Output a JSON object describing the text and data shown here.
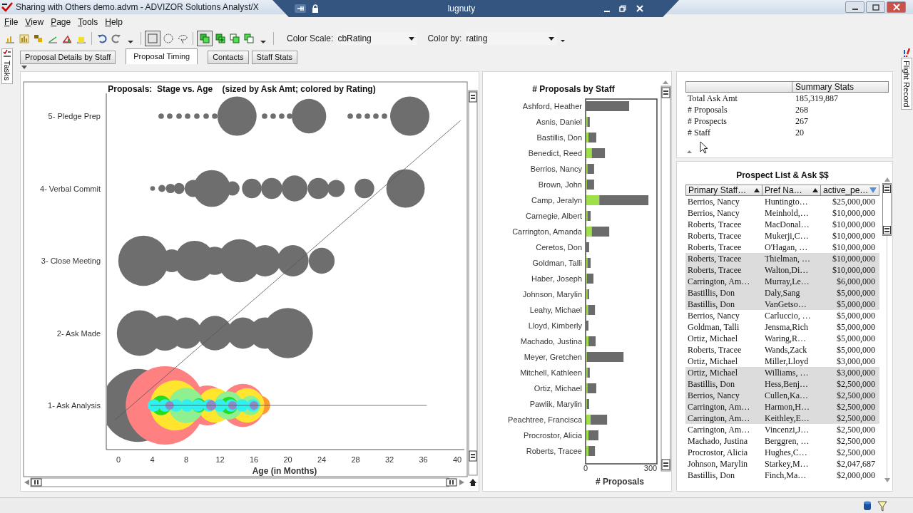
{
  "window": {
    "title": "Sharing with Others demo.advm - ADVIZOR Solutions Analyst/X"
  },
  "remote_bar": {
    "label": "lugnuty"
  },
  "menu": [
    "File",
    "View",
    "Page",
    "Tools",
    "Help"
  ],
  "tools": [
    {
      "kind": "bar-chart",
      "pressed": false
    },
    {
      "kind": "column-chart",
      "pressed": false
    },
    {
      "kind": "block-chart",
      "pressed": false
    },
    {
      "kind": "line-chart",
      "pressed": false
    },
    {
      "kind": "area-chart",
      "pressed": false
    },
    {
      "kind": "histogram-chart",
      "pressed": false
    },
    {
      "kind": "separator",
      "pressed": false
    },
    {
      "kind": "undo",
      "pressed": false
    },
    {
      "kind": "redo",
      "pressed": false
    },
    {
      "kind": "caret",
      "pressed": false
    },
    {
      "kind": "separator",
      "pressed": false
    },
    {
      "kind": "rect-select",
      "pressed": true
    },
    {
      "kind": "circle-select",
      "pressed": false
    },
    {
      "kind": "lasso-select",
      "pressed": false
    },
    {
      "kind": "separator",
      "pressed": false
    },
    {
      "kind": "layer-add",
      "pressed": true
    },
    {
      "kind": "layer-plus",
      "pressed": false
    },
    {
      "kind": "layer-copy",
      "pressed": false
    },
    {
      "kind": "layer-merge",
      "pressed": false
    },
    {
      "kind": "caret",
      "pressed": false
    },
    {
      "kind": "separator",
      "pressed": false
    }
  ],
  "color_scale": {
    "label": "Color Scale:",
    "value": "cbRating"
  },
  "color_by": {
    "label": "Color by:",
    "value": "rating"
  },
  "left_tab": "Tasks",
  "right_tab": "Flight Record",
  "tabs": [
    {
      "label": "Proposal Details by Staff",
      "selected": false
    },
    {
      "label": "Proposal Timing",
      "selected": true
    },
    {
      "label": "Contacts",
      "selected": false
    },
    {
      "label": "Staff Stats",
      "selected": false
    }
  ],
  "bubble_chart": {
    "title": "Proposals:  Stage vs. Age    (sized by Ask Amt; colored by Rating)",
    "stage_labels": [
      "5- Pledge Prep",
      "4- Verbal Commit",
      "3- Close Meeting",
      "2- Ask Made",
      "1- Ask Analysis"
    ],
    "x_ticks": [
      "0",
      "4",
      "8",
      "12",
      "16",
      "20",
      "24",
      "28",
      "32",
      "36",
      "40"
    ],
    "xlabel": "Age (in Months)"
  },
  "bar_chart": {
    "chart_data": {
      "type": "bar",
      "orientation": "horizontal",
      "stacked": true,
      "title": "# Proposals by Staff",
      "xlabel": "# Proposals",
      "categories": [
        "Ashford, Heather",
        "Asnis, Daniel",
        "Bastillis, Don",
        "Benedict, Reed",
        "Berrios, Nancy",
        "Brown, John",
        "Camp, Jeralyn",
        "Carnegie, Albert",
        "Carrington, Amanda",
        "Ceretos, Don",
        "Goldman, Talli",
        "Haber, Joseph",
        "Johnson, Marylin",
        "Leahy, Michael",
        "Lloyd, Kimberly",
        "Machado, Justina",
        "Meyer, Gretchen",
        "Mitchell, Kathleen",
        "Ortiz, Michael",
        "Pawlik, Marylin",
        "Peachtree, Francisca",
        "Procrostor, Alicia",
        "Roberts, Tracee"
      ],
      "xlim": [
        0,
        300
      ],
      "xticks": [
        0,
        300
      ],
      "series": [
        {
          "color": "#9ee04a",
          "values": [
            0,
            5,
            10,
            25,
            5,
            3,
            60,
            5,
            25,
            0,
            5,
            3,
            5,
            8,
            0,
            10,
            3,
            5,
            5,
            3,
            20,
            10,
            10
          ]
        },
        {
          "color": "#6b6b6b",
          "values": [
            198,
            11,
            36,
            61,
            31,
            33,
            227,
            15,
            81,
            13,
            15,
            30,
            8,
            32,
            10,
            33,
            169,
            11,
            41,
            10,
            76,
            46,
            30
          ]
        }
      ]
    }
  },
  "summary": {
    "header": "Summary Stats",
    "rows": [
      {
        "label": "Total Ask Amt",
        "value": "185,319,887"
      },
      {
        "label": "# Proposals",
        "value": "268"
      },
      {
        "label": "# Prospects",
        "value": "267"
      },
      {
        "label": "# Staff",
        "value": "20"
      }
    ]
  },
  "prospects": {
    "title": "Prospect List & Ask $$",
    "columns": [
      {
        "label": "Primary Staff…",
        "descending": false
      },
      {
        "label": "Pref Na…",
        "descending": false
      },
      {
        "label": "active_pe…",
        "descending": true
      }
    ],
    "rows": [
      {
        "cells": [
          "Berrios, Nancy",
          "Huntingto…",
          "$25,000,000"
        ],
        "selected": false
      },
      {
        "cells": [
          "Berrios, Nancy",
          "Meinhold,…",
          "$10,000,000"
        ],
        "selected": false
      },
      {
        "cells": [
          "Roberts, Tracee",
          "MacDonal…",
          "$10,000,000"
        ],
        "selected": false
      },
      {
        "cells": [
          "Roberts, Tracee",
          "Mukerji,C…",
          "$10,000,000"
        ],
        "selected": false
      },
      {
        "cells": [
          "Roberts, Tracee",
          "O'Hagan, …",
          "$10,000,000"
        ],
        "selected": false
      },
      {
        "cells": [
          "Roberts, Tracee",
          "Thielman, …",
          "$10,000,000"
        ],
        "selected": true
      },
      {
        "cells": [
          "Roberts, Tracee",
          "Walton,Di…",
          "$10,000,000"
        ],
        "selected": true
      },
      {
        "cells": [
          "Carrington, Am…",
          "Murray,Le…",
          "$6,000,000"
        ],
        "selected": true
      },
      {
        "cells": [
          "Bastillis, Don",
          "Daly,Sang",
          "$5,000,000"
        ],
        "selected": true
      },
      {
        "cells": [
          "Bastillis, Don",
          "VanGetso…",
          "$5,000,000"
        ],
        "selected": true
      },
      {
        "cells": [
          "Berrios, Nancy",
          "Carluccio, …",
          "$5,000,000"
        ],
        "selected": false
      },
      {
        "cells": [
          "Goldman, Talli",
          "Jensma,Rich",
          "$5,000,000"
        ],
        "selected": false
      },
      {
        "cells": [
          "Ortiz, Michael",
          "Waring,R…",
          "$5,000,000"
        ],
        "selected": false
      },
      {
        "cells": [
          "Roberts, Tracee",
          "Wands,Zack",
          "$5,000,000"
        ],
        "selected": false
      },
      {
        "cells": [
          "Ortiz, Michael",
          "Miller,Lloyd",
          "$3,000,000"
        ],
        "selected": false
      },
      {
        "cells": [
          "Ortiz, Michael",
          "Williams, …",
          "$3,000,000"
        ],
        "selected": true
      },
      {
        "cells": [
          "Bastillis, Don",
          "Hess,Benj…",
          "$2,500,000"
        ],
        "selected": true
      },
      {
        "cells": [
          "Berrios, Nancy",
          "Cullen,Ka…",
          "$2,500,000"
        ],
        "selected": true
      },
      {
        "cells": [
          "Carrington, Am…",
          "Harmon,H…",
          "$2,500,000"
        ],
        "selected": true
      },
      {
        "cells": [
          "Carrington, Am…",
          "Keithley,E…",
          "$2,500,000"
        ],
        "selected": true
      },
      {
        "cells": [
          "Carrington, Am…",
          "Vincenzi,J…",
          "$2,500,000"
        ],
        "selected": false
      },
      {
        "cells": [
          "Machado, Justina",
          "Berggren, …",
          "$2,500,000"
        ],
        "selected": false
      },
      {
        "cells": [
          "Procrostor, Alicia",
          "Hughes,C…",
          "$2,500,000"
        ],
        "selected": false
      },
      {
        "cells": [
          "Johnson, Marylin",
          "Starkey,M…",
          "$2,047,687"
        ],
        "selected": false
      },
      {
        "cells": [
          "Bastillis, Don",
          "Finch,Ma…",
          "$2,000,000"
        ],
        "selected": false
      }
    ]
  }
}
